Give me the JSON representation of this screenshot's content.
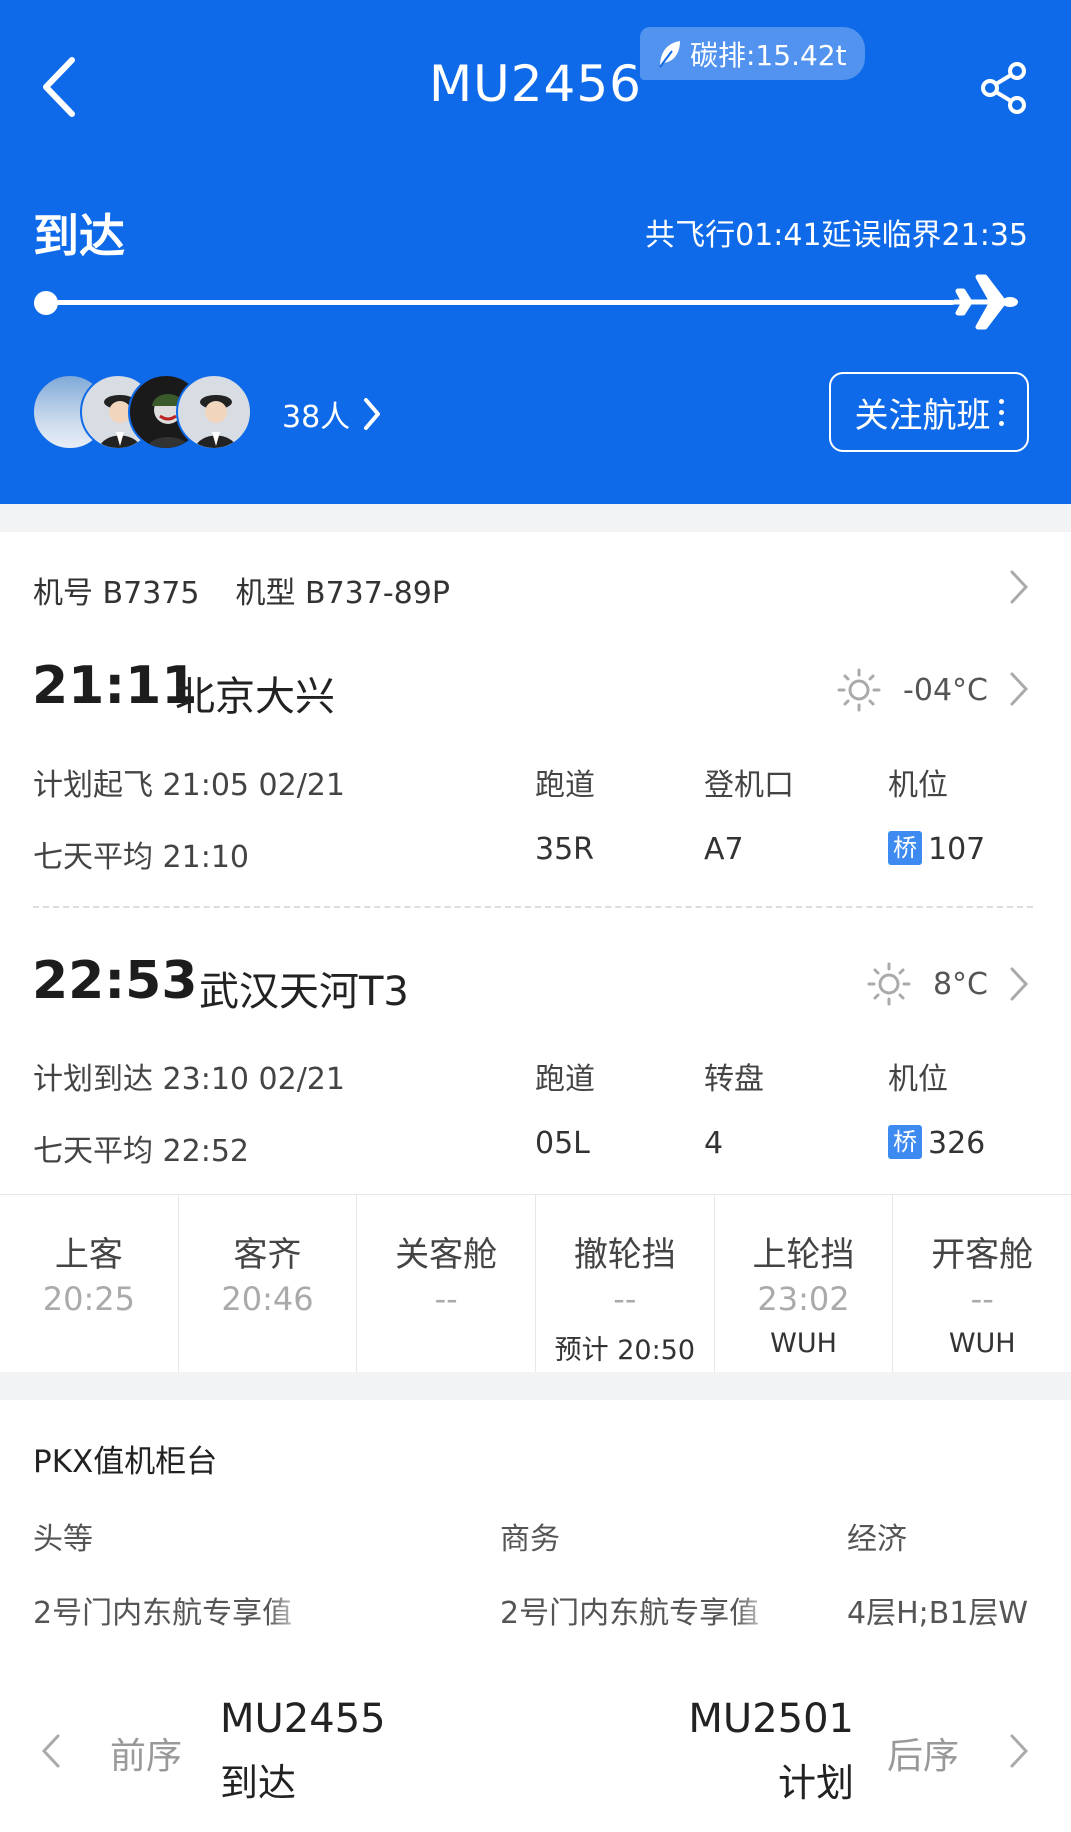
{
  "header": {
    "flight_no": "MU2456",
    "carbon": "碳排:15.42t",
    "status": "到达",
    "flight_time": "共飞行01:41延误临界21:35",
    "people": "38人",
    "follow": "关注航班",
    "bg_color": "#0e6ae8",
    "progress": 1.0
  },
  "aircraft": {
    "reg": "机号 B7375",
    "type": "机型 B737-89P"
  },
  "departure": {
    "time": "21:11",
    "airport": "北京大兴",
    "temp": "-04°C",
    "plan_label": "计划起飞 21:05 02/21",
    "avg_label": "七天平均 21:10",
    "col1_label": "跑道",
    "col1_value": "35R",
    "col2_label": "登机口",
    "col2_value": "A7",
    "col3_label": "机位",
    "col3_badge": "桥",
    "col3_value": "107"
  },
  "arrival": {
    "time": "22:53",
    "airport": "武汉天河T3",
    "temp": "8°C",
    "plan_label": "计划到达 23:10 02/21",
    "avg_label": "七天平均 22:52",
    "col1_label": "跑道",
    "col1_value": "05L",
    "col2_label": "转盘",
    "col2_value": "4",
    "col3_label": "机位",
    "col3_badge": "桥",
    "col3_value": "326"
  },
  "steps": [
    {
      "title": "上客",
      "value": "20:25",
      "sub": ""
    },
    {
      "title": "客齐",
      "value": "20:46",
      "sub": ""
    },
    {
      "title": "关客舱",
      "value": "--",
      "sub": ""
    },
    {
      "title": "撤轮挡",
      "value": "--",
      "sub": "预计 20:50"
    },
    {
      "title": "上轮挡",
      "value": "23:02",
      "sub": "WUH"
    },
    {
      "title": "开客舱",
      "value": "--",
      "sub": "WUH"
    }
  ],
  "counter": {
    "title": "PKX值机柜台",
    "first_label": "头等",
    "first_value": "2号门内东航专享值",
    "business_label": "商务",
    "business_value": "2号门内东航专享值",
    "economy_label": "经济",
    "economy_value": "4层H;B1层W"
  },
  "nav": {
    "prev_label": "前序",
    "prev_flight": "MU2455",
    "prev_status": "到达",
    "next_label": "后序",
    "next_flight": "MU2501",
    "next_status": "计划"
  }
}
